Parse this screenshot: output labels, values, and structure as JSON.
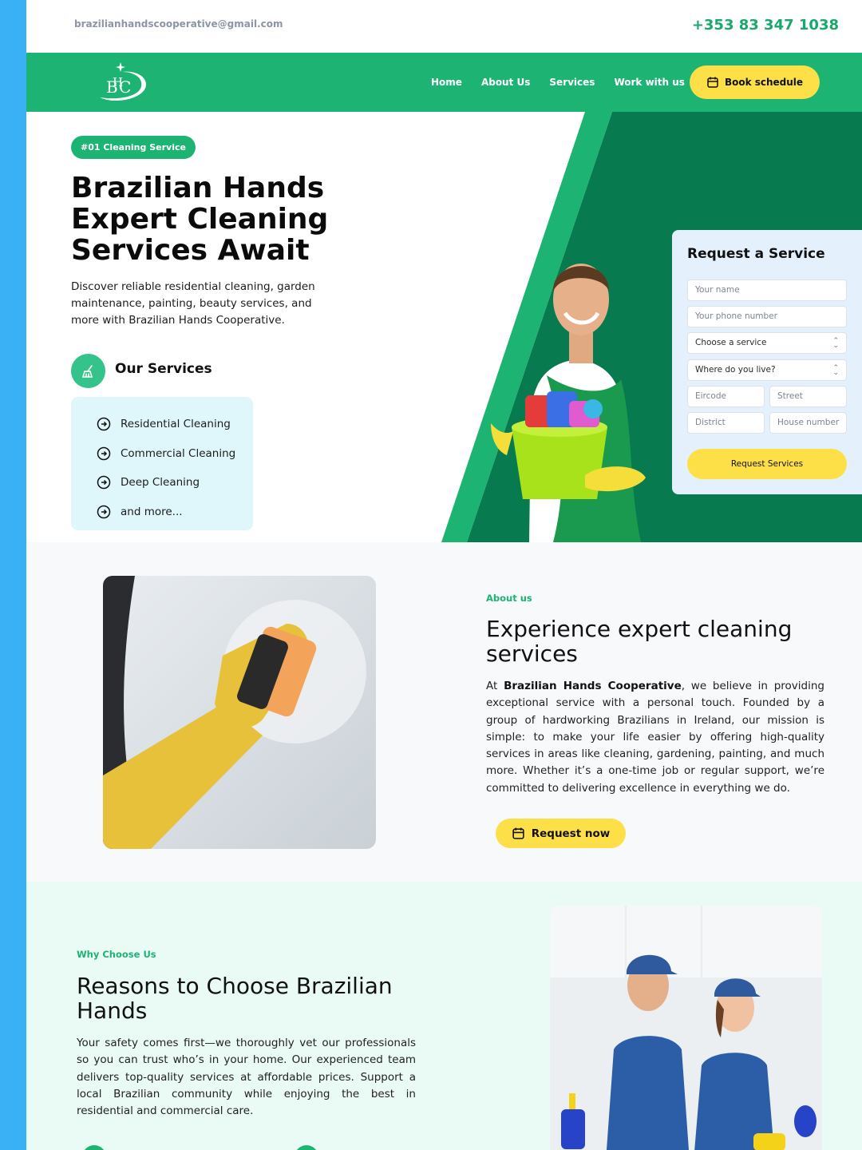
{
  "topbar": {
    "email": "brazilianhandscooperative@gmail.com",
    "phone": "+353 83 347 1038"
  },
  "nav": {
    "logo_text": "BHC",
    "links": [
      "Home",
      "About Us",
      "Services",
      "Work with us"
    ],
    "book_label": "Book schedule"
  },
  "hero": {
    "badge": "#01 Cleaning Service",
    "title_lines": [
      "Brazilian Hands",
      "Expert Cleaning",
      "Services Await"
    ],
    "description": "Discover reliable residential cleaning, garden maintenance, painting, beauty services, and more with Brazilian Hands Cooperative.",
    "services_heading": "Our Services",
    "services": [
      "Residential Cleaning",
      "Commercial Cleaning",
      "Deep Cleaning",
      "and more..."
    ]
  },
  "form": {
    "title": "Request a Service",
    "name_placeholder": "Your name",
    "phone_placeholder": "Your phone number",
    "service_select": "Choose a service",
    "location_select": "Where do you live?",
    "eircode": "Eircode",
    "street": "Street",
    "district": "District",
    "house_number": "House number",
    "submit_label": "Request Services"
  },
  "about": {
    "eyebrow": "About us",
    "title": "Experience expert cleaning services",
    "text_prefix": "At ",
    "text_bold": "Brazilian Hands Cooperative",
    "text_rest": ", we believe in providing exceptional service with a personal touch. Founded by a group of hardworking Brazilians in Ireland, our mission is simple: to make your life easier by offering high-quality services in areas like cleaning, gardening, painting, and much more. Whether it’s a one-time job or regular support, we’re committed to delivering excellence in everything we do.",
    "button_label": "Request now"
  },
  "why": {
    "eyebrow": "Why Choose Us",
    "title": "Reasons to Choose Brazilian Hands",
    "text": "Your safety comes first—we thoroughly vet our professionals so you can trust who’s in your home. Our experienced team delivers top-quality services at affordable prices. Support a local Brazilian community while enjoying the best in residential and commercial care."
  },
  "colors": {
    "brand_green": "#1db473",
    "dark_green": "#077a4f",
    "accent_yellow": "#fde047",
    "side_blue": "#3bb1f5"
  }
}
